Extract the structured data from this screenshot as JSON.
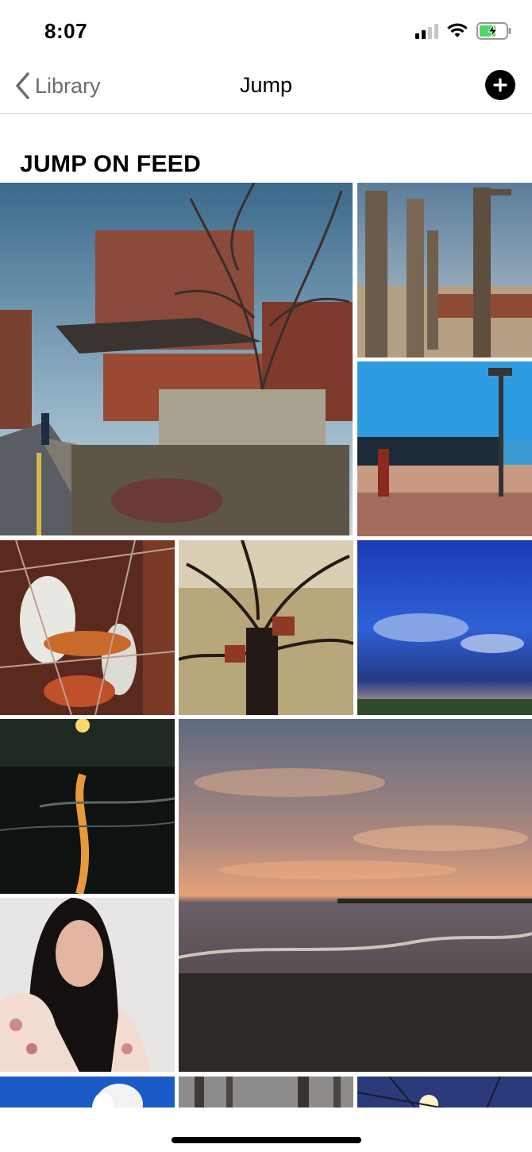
{
  "status_bar": {
    "time": "8:07",
    "icons": [
      "cellular-signal-icon",
      "wifi-icon",
      "battery-charging-icon"
    ]
  },
  "nav": {
    "back_label": "Library",
    "title": "Jump",
    "add_icon": "plus-circle-icon"
  },
  "section": {
    "title": "JUMP ON FEED"
  },
  "photos": [
    {
      "subject": "hanok-house-street"
    },
    {
      "subject": "wooden-totem-poles"
    },
    {
      "subject": "beach-lamp-post"
    },
    {
      "subject": "white-cockatoo"
    },
    {
      "subject": "bare-tree-birdhouses"
    },
    {
      "subject": "blue-storm-sky"
    },
    {
      "subject": "night-sea-reflection"
    },
    {
      "subject": "sunset-pier"
    },
    {
      "subject": "portrait-woman"
    },
    {
      "subject": "white-flower"
    },
    {
      "subject": "forest-trunks"
    },
    {
      "subject": "tree-sunlight"
    }
  ],
  "colors": {
    "text": "#000000",
    "back_gray": "#6b6b6b",
    "divider": "#d2d2d2",
    "battery_green": "#4cd964"
  }
}
